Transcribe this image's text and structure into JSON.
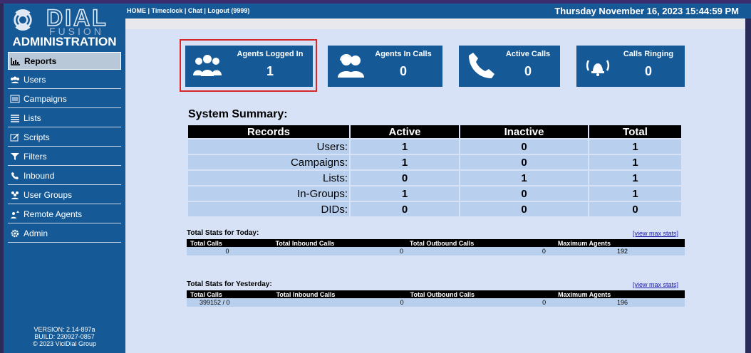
{
  "sidebar": {
    "logo_text": "DIAL FUSION",
    "admin_title": "ADMINISTRATION",
    "items": [
      {
        "label": "Reports",
        "icon": "reports-icon"
      },
      {
        "label": "Users",
        "icon": "users-icon"
      },
      {
        "label": "Campaigns",
        "icon": "campaigns-icon"
      },
      {
        "label": "Lists",
        "icon": "lists-icon"
      },
      {
        "label": "Scripts",
        "icon": "scripts-icon"
      },
      {
        "label": "Filters",
        "icon": "filter-icon"
      },
      {
        "label": "Inbound",
        "icon": "phone-icon"
      },
      {
        "label": "User Groups",
        "icon": "user-groups-icon"
      },
      {
        "label": "Remote Agents",
        "icon": "remote-agents-icon"
      },
      {
        "label": "Admin",
        "icon": "gear-icon"
      }
    ],
    "version": "VERSION: 2.14-897a",
    "build": "BUILD: 230927-0857",
    "copyright": "© 2023 ViciDial Group"
  },
  "header": {
    "links": "HOME | Timeclock | Chat | Logout (9999)",
    "datetime": "Thursday November 16, 2023 15:44:59 PM"
  },
  "cards": [
    {
      "title": "Agents Logged In",
      "value": "1",
      "icon": "agents-group-icon"
    },
    {
      "title": "Agents In Calls",
      "value": "0",
      "icon": "headset-agents-icon"
    },
    {
      "title": "Active Calls",
      "value": "0",
      "icon": "phone-handset-icon"
    },
    {
      "title": "Calls Ringing",
      "value": "0",
      "icon": "bell-icon"
    }
  ],
  "summary": {
    "title": "System Summary:",
    "headers": [
      "Records",
      "Active",
      "Inactive",
      "Total"
    ],
    "rows": [
      [
        "Users:",
        "1",
        "0",
        "1"
      ],
      [
        "Campaigns:",
        "1",
        "0",
        "1"
      ],
      [
        "Lists:",
        "0",
        "1",
        "1"
      ],
      [
        "In-Groups:",
        "1",
        "0",
        "1"
      ],
      [
        "DIDs:",
        "0",
        "0",
        "0"
      ]
    ]
  },
  "today": {
    "title": "Total Stats for Today:",
    "link": "[view max stats]",
    "headers": [
      "Total Calls",
      "Total Inbound Calls",
      "Total Outbound Calls",
      "Maximum Agents"
    ],
    "values": [
      "0",
      "0",
      "0",
      "192"
    ]
  },
  "yesterday": {
    "title": "Total Stats for Yesterday:",
    "link": "[view max stats]",
    "headers": [
      "Total Calls",
      "Total Inbound Calls",
      "Total Outbound Calls",
      "Maximum Agents"
    ],
    "values": [
      "399152 / 0",
      "0",
      "0",
      "196"
    ]
  },
  "colors": {
    "primary": "#155a96",
    "background": "#d7e2f6",
    "row": "#b8d0ee",
    "highlight": "#d6272b"
  }
}
